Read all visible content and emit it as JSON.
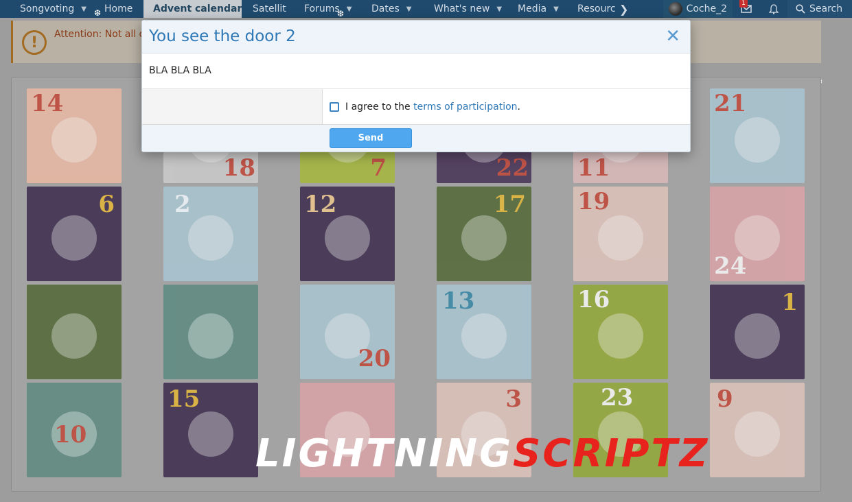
{
  "nav": {
    "items": [
      {
        "label": "Songvoting",
        "dropdown": true
      },
      {
        "label": "Home",
        "dropdown": false
      },
      {
        "label": "Advent calendar",
        "dropdown": false,
        "active": true
      },
      {
        "label": "Satellit",
        "dropdown": false
      },
      {
        "label": "Forums",
        "dropdown": true
      },
      {
        "label": "Dates",
        "dropdown": true
      },
      {
        "label": "What's new",
        "dropdown": true
      },
      {
        "label": "Media",
        "dropdown": true
      },
      {
        "label": "Resource",
        "dropdown": false
      }
    ],
    "more_glyph": "❯",
    "dropdown_glyph": "▼",
    "username": "Coche_2",
    "inbox_count": "1",
    "search_label": "Search",
    "snowflake": "❆"
  },
  "notice": {
    "icon_glyph": "!",
    "text": "Attention: Not all d"
  },
  "calendar": {
    "tiles": [
      {
        "num": "14",
        "bg": "#e8b8a3"
      },
      {
        "num": "18",
        "bg": "#c9c9c9"
      },
      {
        "num": "7",
        "bg": "#a6b840"
      },
      {
        "num": "22",
        "bg": "#4a3559"
      },
      {
        "num": "11",
        "bg": "#d9b9b9"
      },
      {
        "num": "21",
        "bg": "#a9c4d0"
      },
      {
        "num": "6",
        "bg": "#3f2f4f"
      },
      {
        "num": "2",
        "bg": "#a9c4d0"
      },
      {
        "num": "12",
        "bg": "#3f2f4f"
      },
      {
        "num": "17",
        "bg": "#546a3a"
      },
      {
        "num": "19",
        "bg": "#dcc2b9"
      },
      {
        "num": "24",
        "bg": "#d9a3a7"
      },
      {
        "num": "",
        "bg": "#546a3a"
      },
      {
        "num": "",
        "bg": "#5f8b82"
      },
      {
        "num": "20",
        "bg": "#a9c4d0"
      },
      {
        "num": "13",
        "bg": "#a9c4d0"
      },
      {
        "num": "16",
        "bg": "#93a83a"
      },
      {
        "num": "1",
        "bg": "#3f2f4f"
      },
      {
        "num": "10",
        "bg": "#5f8b82"
      },
      {
        "num": "15",
        "bg": "#3f2f4f"
      },
      {
        "num": "",
        "bg": "#d9a3a7"
      },
      {
        "num": "3",
        "bg": "#dcc2b9"
      },
      {
        "num": "23",
        "bg": "#93a83a"
      },
      {
        "num": "9",
        "bg": "#dcc2b9"
      }
    ]
  },
  "modal": {
    "title": "You see the door 2",
    "close_glyph": "✕",
    "body_text": "BLA BLA BLA",
    "agree_prefix": "I agree to the ",
    "terms_link": "terms of participation",
    "agree_suffix": ".",
    "send_label": "Send"
  },
  "watermark": {
    "part1": "LIGHTNING",
    "part2": "SCRIPTZ"
  },
  "colors": {
    "navbar": "#1f4a6d",
    "accent": "#2f78b6",
    "send_button": "#4ea7ef"
  }
}
